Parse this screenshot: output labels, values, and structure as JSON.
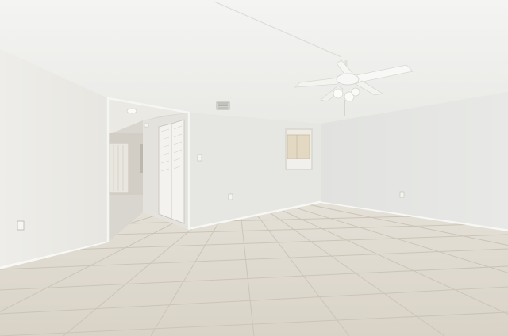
{
  "scene": {
    "subject": "empty-room-interior",
    "colors": {
      "ceiling": "#f1f0ee",
      "wall_left": "#ecebe7",
      "wall_back": "#e6e6e2",
      "wall_right": "#e2e3e0",
      "floor": "#dcd7cc",
      "tile_grout": "#c9c3b6",
      "baseboard": "#f7f7f4",
      "fan": "#f8f8f6",
      "hall_wall": "#d6d3cb",
      "closet_door": "#f3f2ee"
    }
  }
}
